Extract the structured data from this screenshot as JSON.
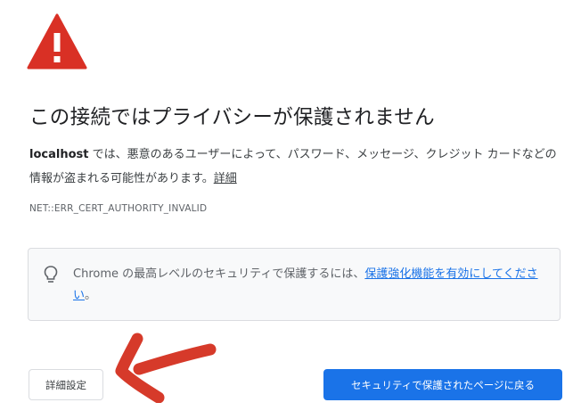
{
  "page": {
    "title": "この接続ではプライバシーが保護されません",
    "host": "localhost",
    "explanation": " では、悪意のあるユーザーによって、パスワード、メッセージ、クレジット カードなどの情報が盗まれる可能性があります。",
    "details_link": "詳細",
    "error_code": "NET::ERR_CERT_AUTHORITY_INVALID"
  },
  "protection": {
    "text": "Chrome の最高レベルのセキュリティで保護するには、",
    "link": "保護強化機能を有効にしてください",
    "suffix": "。"
  },
  "buttons": {
    "advanced": "詳細設定",
    "back_to_safety": "セキュリティで保護されたページに戻る"
  },
  "icons": {
    "warning": "warning-triangle-icon",
    "bulb": "lightbulb-icon",
    "annotation": "hand-drawn-arrow"
  },
  "colors": {
    "warning_red": "#d93025",
    "link_blue": "#1a73e8",
    "button_blue": "#1a73e8",
    "annotation_red": "#d63a2a"
  }
}
